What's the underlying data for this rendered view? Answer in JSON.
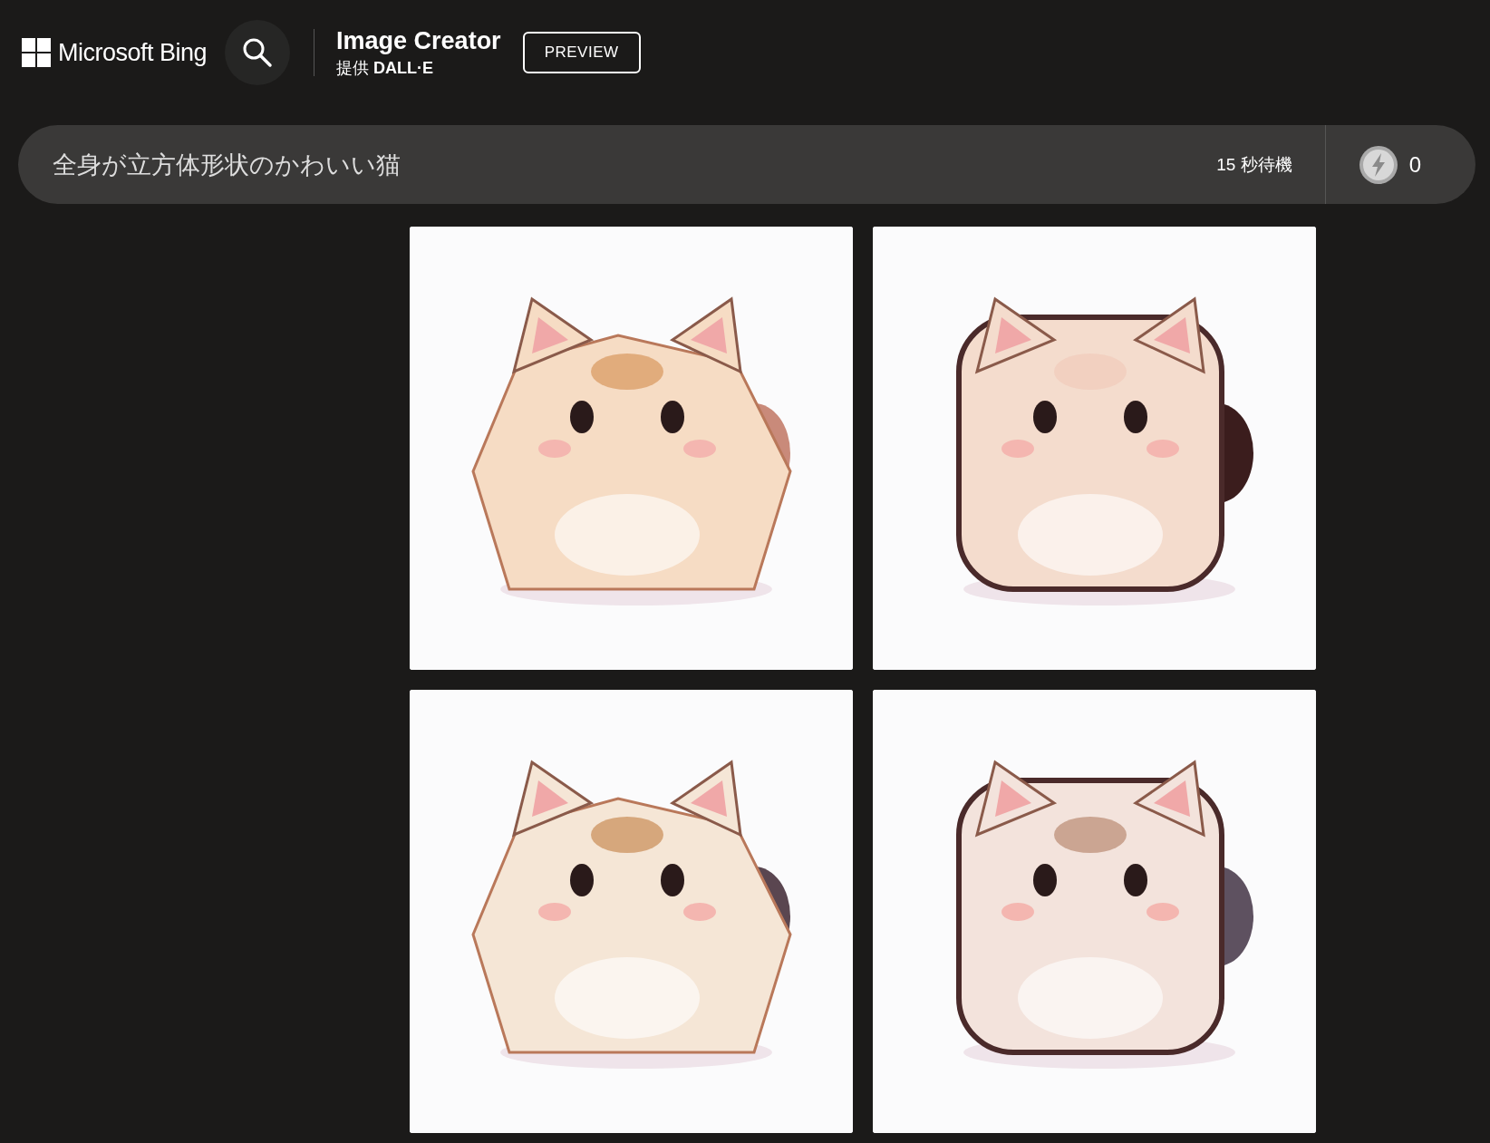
{
  "header": {
    "brand": "Microsoft Bing",
    "product_title": "Image Creator",
    "provider": "提供 **DALL·E**",
    "preview_badge": "PREVIEW"
  },
  "prompt_bar": {
    "value": "全身が立方体形状のかわいい猫",
    "wait_status": "15 秒待機",
    "boost_count": "0"
  }
}
